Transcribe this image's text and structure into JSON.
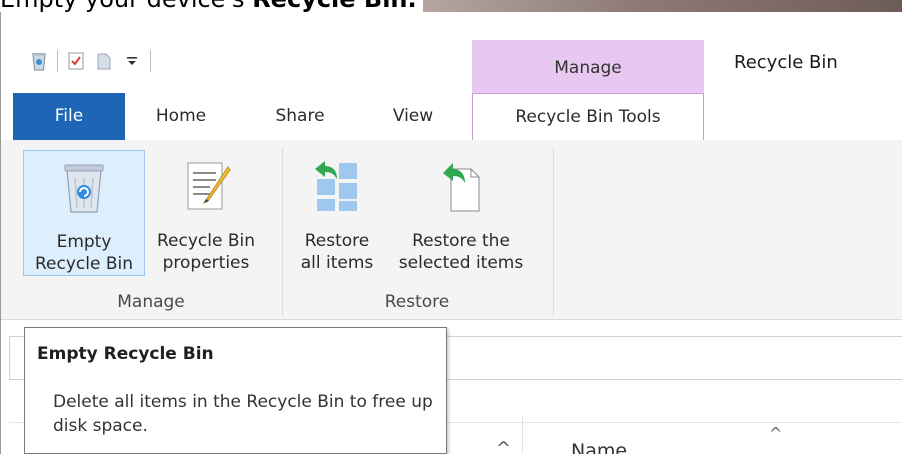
{
  "article": {
    "heading_prefix": "Empty your device's ",
    "heading_bold": "Recycle Bin."
  },
  "window": {
    "title": "Recycle Bin",
    "context_tab": "Manage"
  },
  "quick_access": {
    "icons": [
      "recycle-bin-icon",
      "properties-check-icon",
      "new-folder-icon",
      "customize-dropdown-icon"
    ]
  },
  "tabs": [
    {
      "label": "File"
    },
    {
      "label": "Home"
    },
    {
      "label": "Share"
    },
    {
      "label": "View"
    },
    {
      "label": "Recycle Bin Tools"
    }
  ],
  "ribbon": {
    "buttons": [
      {
        "line1": "Empty",
        "line2": "Recycle Bin"
      },
      {
        "line1": "Recycle Bin",
        "line2": "properties"
      },
      {
        "line1": "Restore",
        "line2": "all items"
      },
      {
        "line1": "Restore the",
        "line2": "selected items"
      }
    ],
    "groups": [
      {
        "label": "Manage"
      },
      {
        "label": "Restore"
      }
    ]
  },
  "list": {
    "name_column": "Name"
  },
  "tooltip": {
    "title": "Empty Recycle Bin",
    "description": "Delete all items in the Recycle Bin to free up disk space."
  },
  "colors": {
    "file_tab": "#1e66b5",
    "context_tab_bg": "#e8c8f0",
    "restore_arrow": "#2fa84f"
  }
}
